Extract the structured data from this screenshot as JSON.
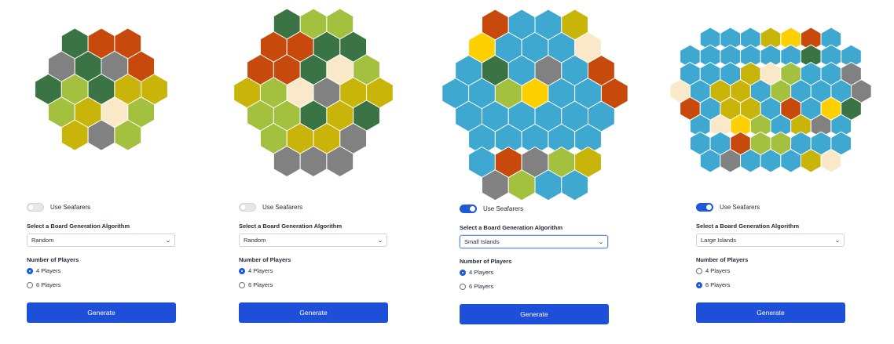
{
  "colors": {
    "forest": "#3a7444",
    "brick": "#c8490c",
    "mountain": "#818181",
    "pasture": "#a3c13f",
    "grain": "#c9b50a",
    "desert": "#fae9c8",
    "sea": "#3ea8d0",
    "gold": "#ffd000",
    "accent": "#1d4fd8"
  },
  "panels": [
    {
      "seafarers_label": "Use Seafarers",
      "seafarers_on": false,
      "algo_label": "Select a Board Generation Algorithm",
      "algo_value": "Random",
      "players_label": "Number of Players",
      "players_options": [
        "4 Players",
        "6 Players"
      ],
      "players_selected": 0,
      "generate_label": "Generate",
      "board": {
        "rows": [
          "FBB",
          "MFMB",
          "FPFGG",
          "PGDP",
          "GMP"
        ]
      }
    },
    {
      "seafarers_label": "Use Seafarers",
      "seafarers_on": false,
      "algo_label": "Select a Board Generation Algorithm",
      "algo_value": "Random",
      "players_label": "Number of Players",
      "players_options": [
        "4 Players",
        "6 Players"
      ],
      "players_selected": 0,
      "generate_label": "Generate",
      "board": {
        "rows": [
          "FPP",
          "BBFF",
          "BBFDP",
          "GPDMGG",
          "PPFGF",
          "PGGM",
          "MMM"
        ]
      }
    },
    {
      "seafarers_label": "Use Seafarers",
      "seafarers_on": true,
      "algo_label": "Select a Board Generation Algorithm",
      "algo_value": "Small Islands",
      "players_label": "Number of Players",
      "players_options": [
        "4 Players",
        "6 Players"
      ],
      "players_selected": 0,
      "generate_label": "Generate",
      "board": {
        "rows": [
          "BSSG",
          "ASSSD",
          "SFSMSB",
          "SSPASSB",
          "SSSSSS",
          "SSSSS",
          "SBMPG",
          "MPSS"
        ]
      }
    },
    {
      "seafarers_label": "Use Seafarers",
      "seafarers_on": true,
      "algo_label": "Select a Board Generation Algorithm",
      "algo_value": "Large Islands",
      "players_label": "Number of Players",
      "players_options": [
        "4 Players",
        "6 Players"
      ],
      "players_selected": 1,
      "generate_label": "Generate",
      "board": {
        "rows": [
          "SSSGABS",
          "SSSSSSFSS",
          "SSSGDPSSM",
          "DSGGSPSSSM",
          "BSGGSBSAF",
          "SDAPSGMS",
          "SSBPPSSS",
          "SMSSSGD"
        ]
      }
    }
  ]
}
